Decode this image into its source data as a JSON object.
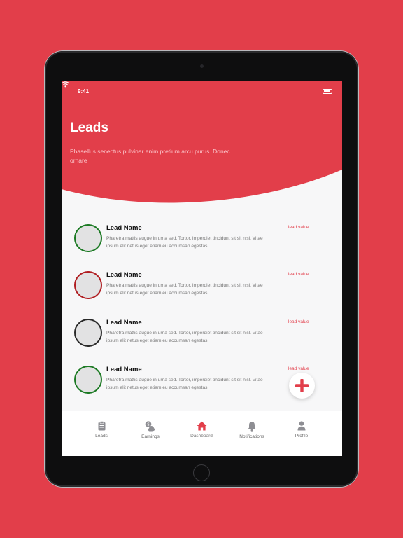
{
  "status_bar": {
    "time": "9:41"
  },
  "header": {
    "title": "Leads",
    "subtitle": "Phasellus senectus pulvinar enim pretium arcu purus. Donec ornare"
  },
  "leads": [
    {
      "name": "Lead Name",
      "description": "Pharetra mattis augue in urna sed. Tortor, imperdiet tincidunt sit sit nisl. Vitae ipsum elit netus eget etiam eu accumsan egestas.",
      "value": "lead value",
      "ring_color": "#1C7A24"
    },
    {
      "name": "Lead Name",
      "description": "Pharetra mattis augue in urna sed. Tortor, imperdiet tincidunt sit sit nisl. Vitae ipsum elit netus eget etiam eu accumsan egestas.",
      "value": "lead value",
      "ring_color": "#B01E22"
    },
    {
      "name": "Lead Name",
      "description": "Pharetra mattis augue in urna sed. Tortor, imperdiet tincidunt sit sit nisl. Vitae ipsum elit netus eget etiam eu accumsan egestas.",
      "value": "lead value",
      "ring_color": "#2A2A2A"
    },
    {
      "name": "Lead Name",
      "description": "Pharetra mattis augue in urna sed. Tortor, imperdiet tincidunt sit sit nisl. Vitae ipsum elit netus eget etiam eu accumsan egestas.",
      "value": "lead value",
      "ring_color": "#1C7A24"
    }
  ],
  "tabbar": {
    "items": [
      {
        "label": "Leads",
        "icon": "clipboard-icon"
      },
      {
        "label": "Earnings",
        "icon": "money-bag-icon"
      },
      {
        "label": "Dashboard",
        "icon": "home-icon"
      },
      {
        "label": "Notifications",
        "icon": "bell-icon"
      },
      {
        "label": "Profile",
        "icon": "user-icon"
      }
    ],
    "active": "Dashboard"
  },
  "colors": {
    "brand": "#E23E4A",
    "icon_inactive": "#8E8E93",
    "icon_active": "#E23E4A"
  }
}
